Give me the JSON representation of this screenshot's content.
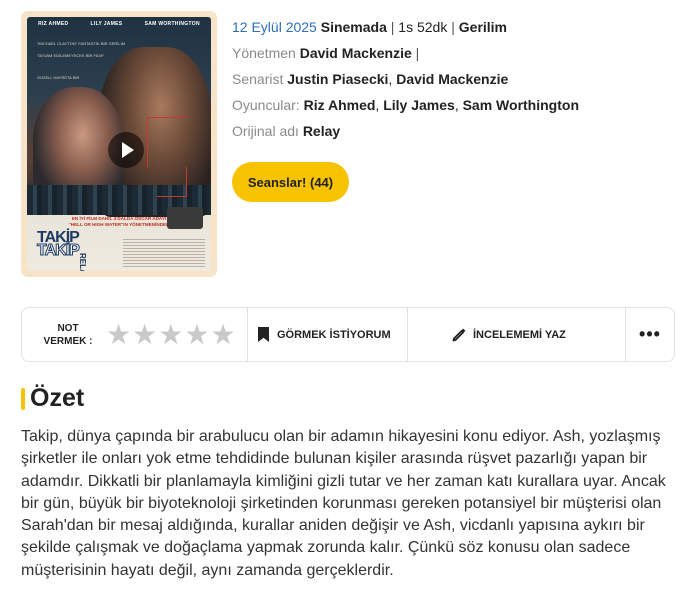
{
  "poster": {
    "cast_top": [
      "RIZ AHMED",
      "LILY JAMES",
      "SAM WORTHINGTON"
    ],
    "quote_1": "\"MICHAEL CLAYTON\" FANTASTİK BİR GERİLİM",
    "quote_2": "\"DEVAM EDİLEMEYECEK BİR FİLM\"",
    "quote_3": "GÜZELL HAYRETA BİR",
    "tagline_1": "EN İYİ FİLM DAHİL 4 DALDA OSCAR ADAYI",
    "tagline_2": "\"HELL OR HIGH WATER\"IN YÖNETMENİNDEN",
    "title_line1": "TAKİP",
    "title_line2": "TAKİP",
    "title_side": "RELAY",
    "play_icon": "play-icon"
  },
  "info": {
    "release_date": "12 Eylül 2025",
    "release_status": "Sinemada",
    "sep": "|",
    "duration": "1s 52dk",
    "genre": "Gerilim",
    "director_label": "Yönetmen",
    "director": "David Mackenzie",
    "writer_label": "Senarist",
    "writers": [
      "Justin Piasecki",
      "David Mackenzie"
    ],
    "cast_label": "Oyuncular:",
    "cast": [
      "Riz Ahmed",
      "Lily James",
      "Sam Worthington"
    ],
    "original_title_label": "Orijinal adı",
    "original_title": "Relay",
    "comma": ","
  },
  "showtimes_button": "Seanslar! (44)",
  "action_bar": {
    "rate_label_1": "NOT",
    "rate_label_2": "VERMEK :",
    "stars": 5,
    "star_glyph": "★",
    "watchlist_label": "GÖRMEK İSTİYORUM",
    "review_label": "İNCELEMEMİ YAZ",
    "more_label": "•••"
  },
  "summary": {
    "heading": "Özet",
    "text": "Takip, dünya çapında bir arabulucu olan bir adamın hikayesini konu ediyor. Ash, yozlaşmış şirketler ile onları yok etme tehdidinde bulunan kişiler arasında rüşvet pazarlığı yapan bir adamdır. Dikkatli bir planlamayla kimliğini gizli tutar ve her zaman katı kurallara uyar. Ancak bir gün, büyük bir biyoteknoloji şirketinden korunması gereken potansiyel bir müşterisi olan Sarah'dan bir mesaj aldığında, kurallar aniden değişir ve Ash, vicdanlı yapısına aykırı bir şekilde çalışmak ve doğaçlama yapmak zorunda kalır. Çünkü söz konusu olan sadece müşterisinin hayatı değil, aynı zamanda gerçeklerdir."
  },
  "colors": {
    "accent_yellow": "#f7c300",
    "link_blue": "#2f6fb5",
    "poster_bg": "#f6e3c8",
    "star_empty": "#c9c9c9"
  }
}
